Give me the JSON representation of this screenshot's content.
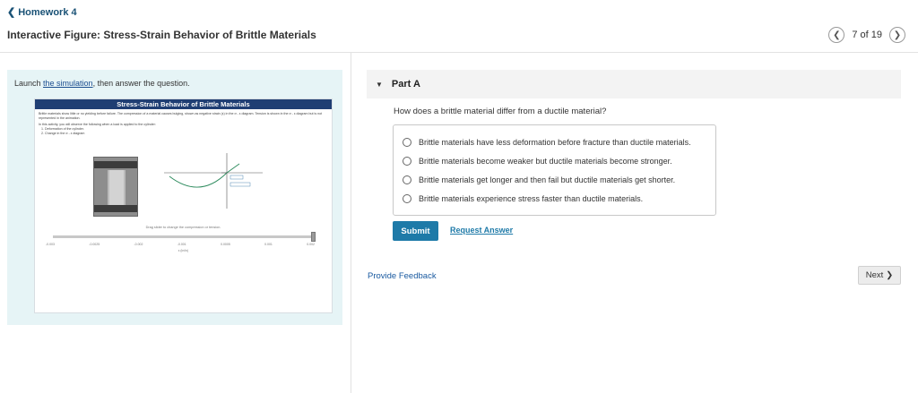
{
  "nav": {
    "back_label": "Homework 4",
    "title": "Interactive Figure: Stress-Strain Behavior of Brittle Materials",
    "pager_text": "7 of 19"
  },
  "left": {
    "launch_prefix": "Launch ",
    "launch_link": "the simulation",
    "launch_suffix": ", then answer the question.",
    "sim_title": "Stress-Strain Behavior of Brittle Materials",
    "sim_desc_1": "Brittle materials show little or no yielding before failure. The compression of a material causes bulging, shown as negative strain (ε) in the σ - ε diagram. Tension is shown in the σ - ε diagram but is not represented in the animation.",
    "sim_desc_2": "In this activity, you will observe the following when a load is applied to the cylinder:",
    "sim_desc_3": "1. Deformation of the cylinder.",
    "sim_desc_4": "2. Change in the σ - ε diagram",
    "sim_caption": "Drag slider to change the compression or tension.",
    "sim_ticks": [
      "-0.003",
      "-0.0025",
      "-0.002",
      "-0.001",
      "0.0005",
      "0.001",
      "0.002"
    ],
    "sim_axis": "ε (in/in)"
  },
  "part": {
    "label": "Part A",
    "question": "How does a brittle material differ from a ductile material?",
    "choices": [
      "Brittle materials have less deformation before fracture than ductile materials.",
      "Brittle materials become weaker but ductile materials become stronger.",
      "Brittle materials get longer and then fail but ductile materials get shorter.",
      "Brittle materials experience stress faster than ductile materials."
    ],
    "submit_label": "Submit",
    "request_label": "Request Answer"
  },
  "footer": {
    "feedback_label": "Provide Feedback",
    "next_label": "Next"
  },
  "colors": {
    "accent": "#1e7aa8",
    "panel_bg": "#e6f4f6",
    "sim_header": "#1f3e73"
  }
}
